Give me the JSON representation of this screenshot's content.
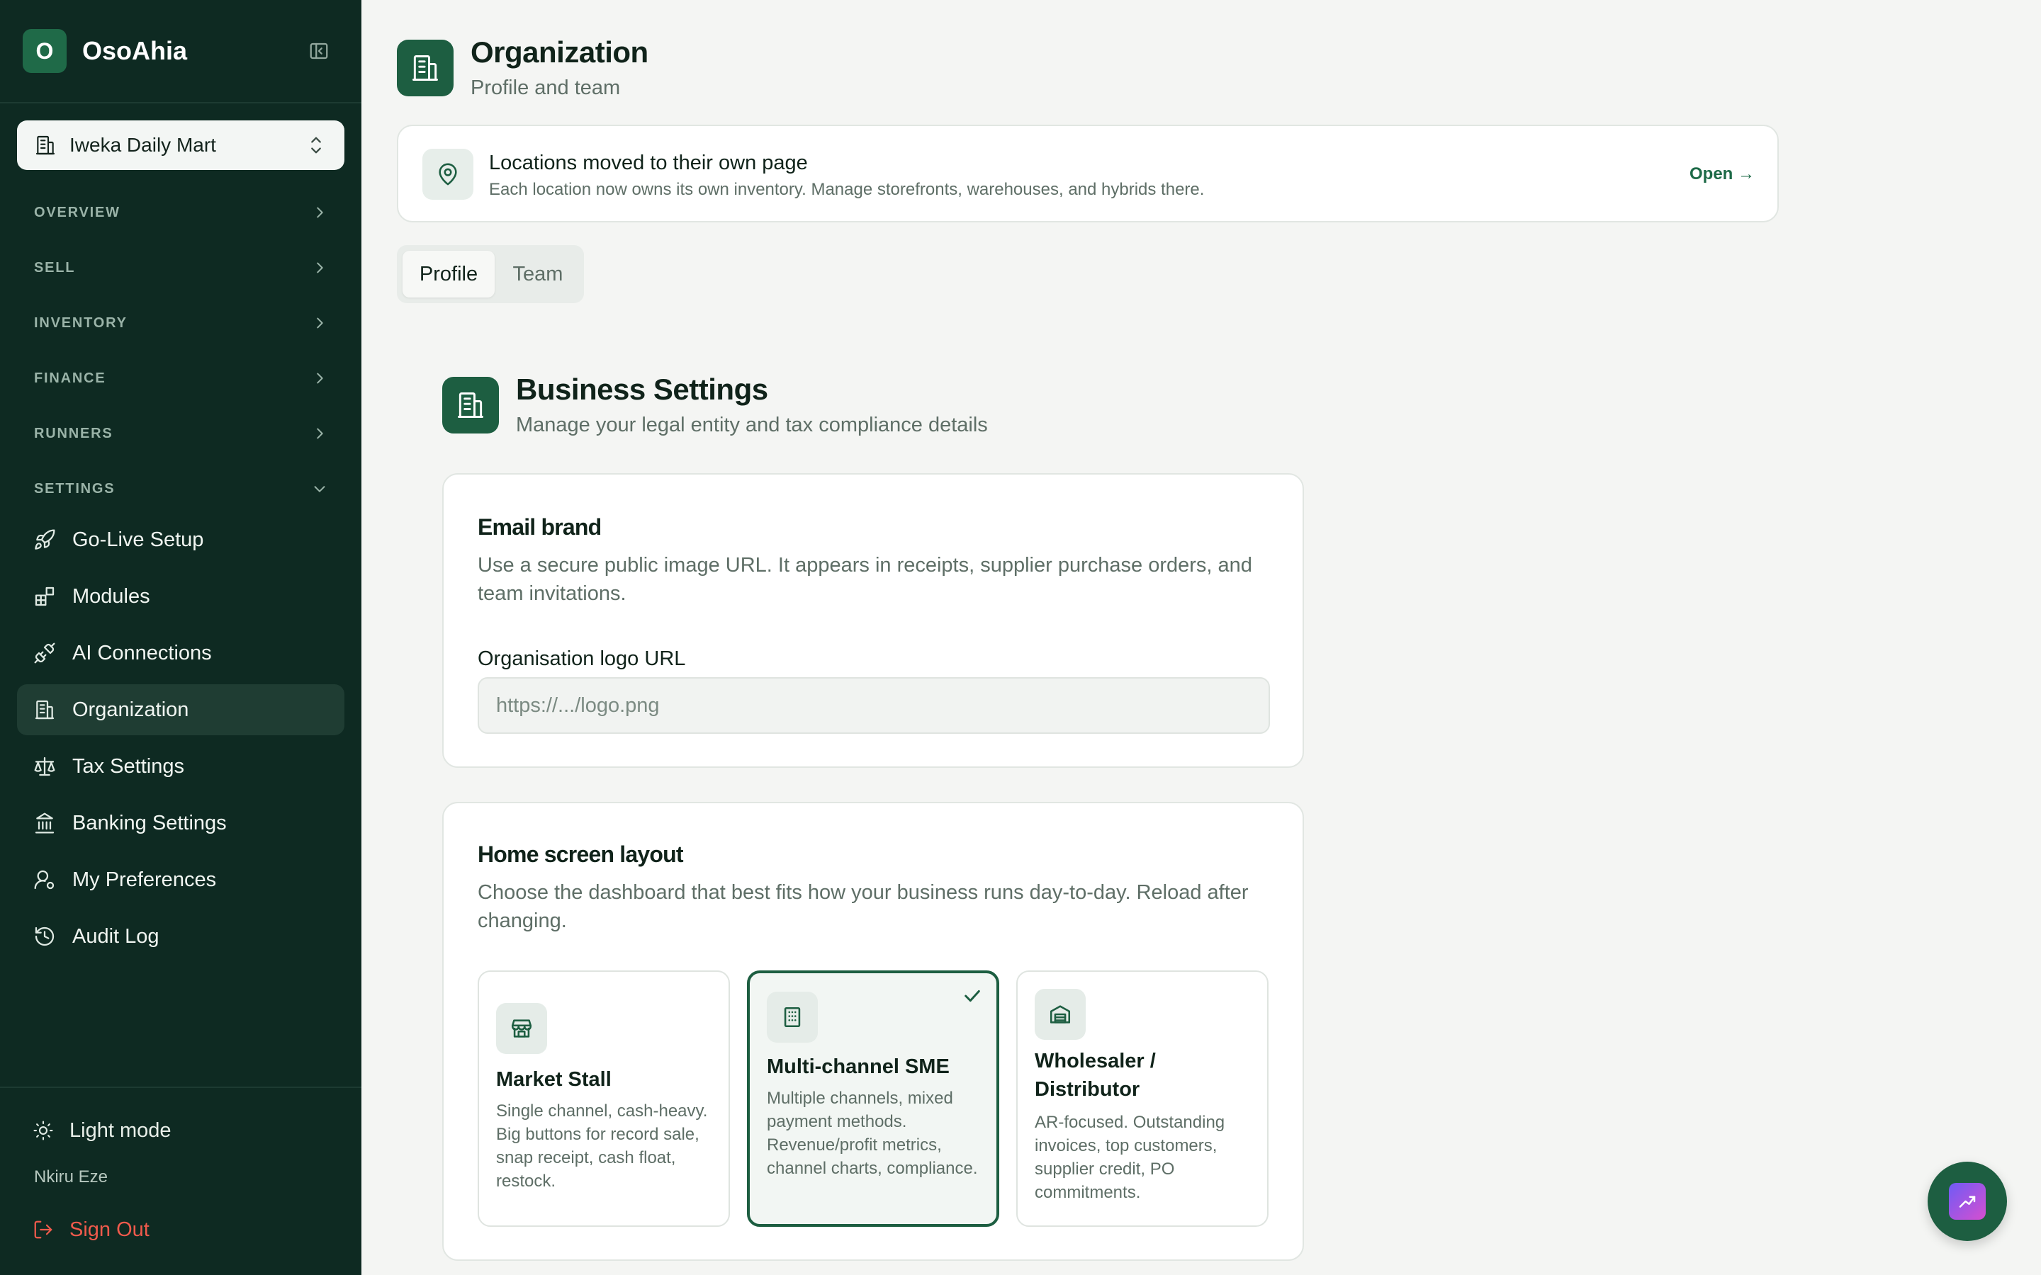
{
  "app": {
    "brand_initial": "O",
    "brand_name": "OsoAhia"
  },
  "sidebar": {
    "org_selector": "Iweka Daily Mart",
    "sections": [
      {
        "label": "OVERVIEW",
        "expanded": false
      },
      {
        "label": "SELL",
        "expanded": false
      },
      {
        "label": "INVENTORY",
        "expanded": false
      },
      {
        "label": "FINANCE",
        "expanded": false
      },
      {
        "label": "RUNNERS",
        "expanded": false
      },
      {
        "label": "SETTINGS",
        "expanded": true
      }
    ],
    "items": [
      {
        "label": "Go-Live Setup",
        "icon": "rocket-icon"
      },
      {
        "label": "Modules",
        "icon": "modules-icon"
      },
      {
        "label": "AI Connections",
        "icon": "plug-icon"
      },
      {
        "label": "Organization",
        "icon": "building-icon",
        "active": true
      },
      {
        "label": "Tax Settings",
        "icon": "scale-icon"
      },
      {
        "label": "Banking Settings",
        "icon": "bank-icon"
      },
      {
        "label": "My Preferences",
        "icon": "user-gear-icon"
      },
      {
        "label": "Audit Log",
        "icon": "history-icon"
      }
    ],
    "footer": {
      "light_mode": "Light mode",
      "user_name": "Nkiru Eze",
      "sign_out": "Sign Out"
    }
  },
  "header": {
    "title": "Organization",
    "subtitle": "Profile and team"
  },
  "notice": {
    "title": "Locations moved to their own page",
    "description": "Each location now owns its own inventory. Manage storefronts, warehouses, and hybrids there.",
    "action": "Open →"
  },
  "tabs": [
    {
      "label": "Profile",
      "active": true
    },
    {
      "label": "Team",
      "active": false
    }
  ],
  "business_settings": {
    "title": "Business Settings",
    "subtitle": "Manage your legal entity and tax compliance details"
  },
  "email_brand": {
    "title": "Email brand",
    "description": "Use a secure public image URL. It appears in receipts, supplier purchase orders, and team invitations.",
    "field_label": "Organisation logo URL",
    "placeholder": "https://.../logo.png",
    "value": ""
  },
  "home_layout": {
    "title": "Home screen layout",
    "description": "Choose the dashboard that best fits how your business runs day-to-day. Reload after changing.",
    "options": [
      {
        "title": "Market Stall",
        "description": "Single channel, cash-heavy. Big buttons for record sale, snap receipt, cash float, restock.",
        "icon": "store-icon",
        "selected": false
      },
      {
        "title": "Multi-channel SME",
        "description": "Multiple channels, mixed payment methods. Revenue/profit metrics, channel charts, compliance.",
        "icon": "office-building-icon",
        "selected": true
      },
      {
        "title": "Wholesaler / Distributor",
        "description": "AR-focused. Outstanding invoices, top customers, supplier credit, PO commitments.",
        "icon": "warehouse-icon",
        "selected": false
      }
    ]
  },
  "colors": {
    "sidebar_bg": "#0e2a22",
    "accent": "#1d5e41",
    "sign_out": "#ef5a4c",
    "page_bg": "#f4f5f3"
  }
}
